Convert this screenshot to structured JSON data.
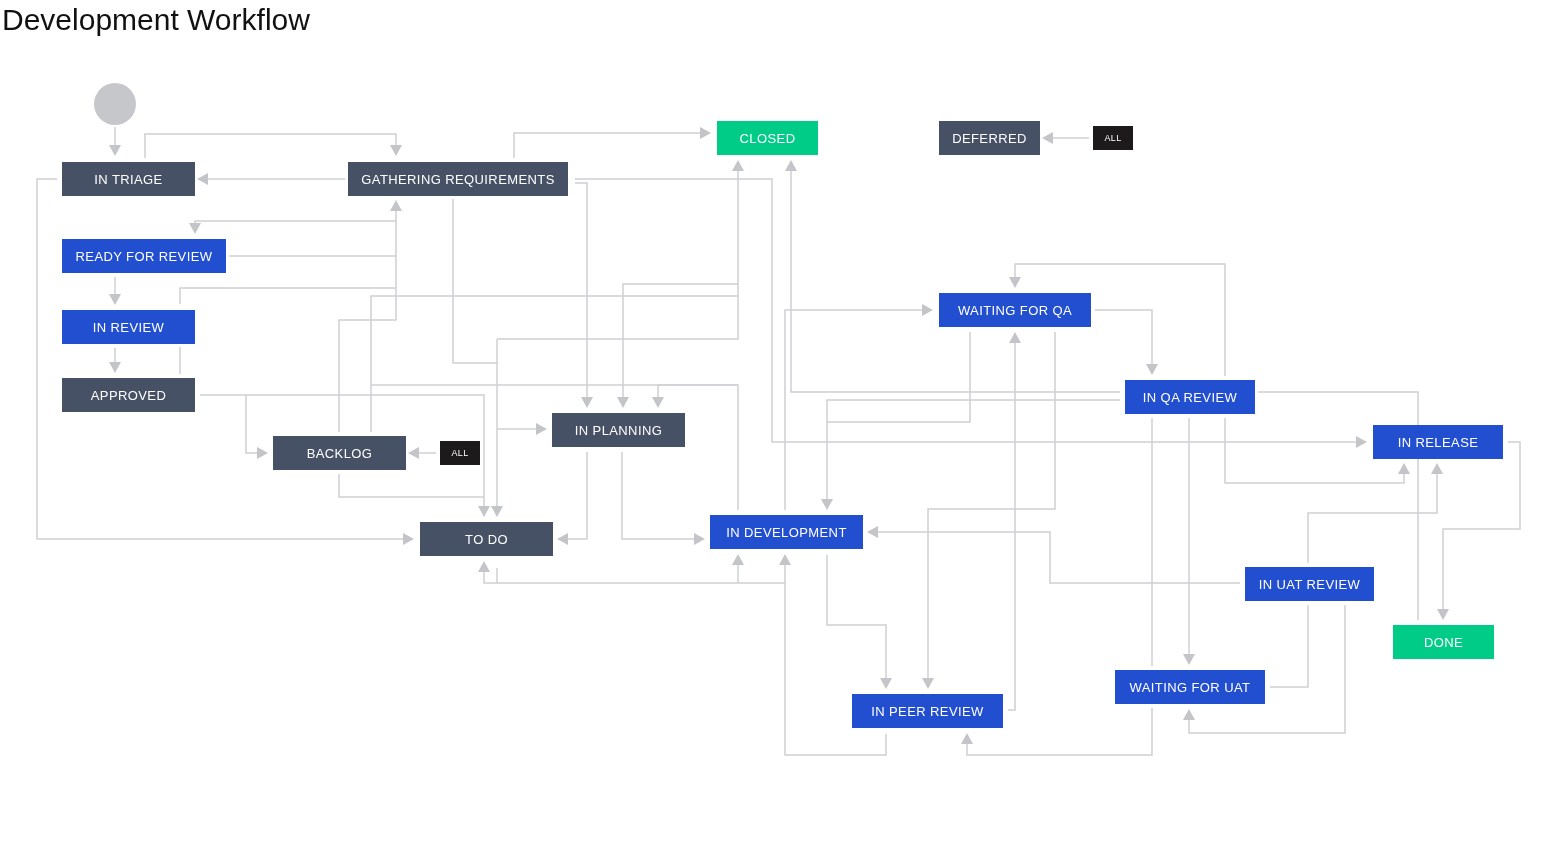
{
  "title": "Development Workflow",
  "nodes": [
    {
      "label": "IN TRIAGE",
      "kind": "todo"
    },
    {
      "label": "GATHERING REQUIREMENTS",
      "kind": "todo"
    },
    {
      "label": "CLOSED",
      "kind": "done"
    },
    {
      "label": "DEFERRED",
      "kind": "todo"
    },
    {
      "label": "ALL",
      "kind": "global"
    },
    {
      "label": "READY FOR REVIEW",
      "kind": "progress"
    },
    {
      "label": "IN REVIEW",
      "kind": "progress"
    },
    {
      "label": "APPROVED",
      "kind": "todo"
    },
    {
      "label": "BACKLOG",
      "kind": "todo"
    },
    {
      "label": "ALL",
      "kind": "global"
    },
    {
      "label": "IN PLANNING",
      "kind": "todo"
    },
    {
      "label": "TO DO",
      "kind": "todo"
    },
    {
      "label": "IN DEVELOPMENT",
      "kind": "progress"
    },
    {
      "label": "WAITING FOR QA",
      "kind": "progress"
    },
    {
      "label": "IN QA REVIEW",
      "kind": "progress"
    },
    {
      "label": "IN RELEASE",
      "kind": "progress"
    },
    {
      "label": "IN UAT REVIEW",
      "kind": "progress"
    },
    {
      "label": "DONE",
      "kind": "done"
    },
    {
      "label": "WAITING FOR UAT",
      "kind": "progress"
    },
    {
      "label": "IN PEER REVIEW",
      "kind": "progress"
    }
  ]
}
